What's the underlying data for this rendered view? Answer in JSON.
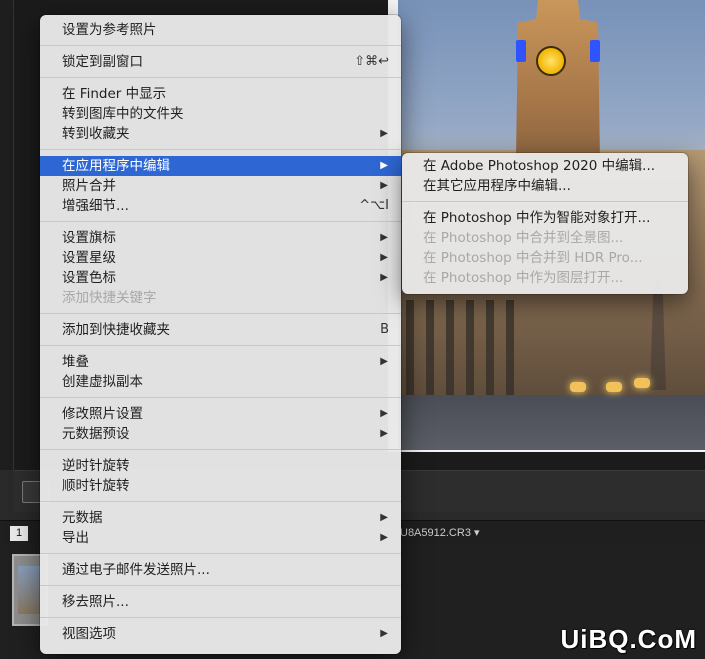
{
  "background": {
    "page_number": "1",
    "filename": "U8A5912.CR3 ▾"
  },
  "menu": {
    "items": [
      {
        "label": "设置为参考照片"
      },
      {
        "separator": true
      },
      {
        "label": "锁定到副窗口",
        "shortcut": "⇧⌘↩"
      },
      {
        "separator": true
      },
      {
        "label": "在 Finder 中显示"
      },
      {
        "label": "转到图库中的文件夹"
      },
      {
        "label": "转到收藏夹",
        "submenu": true
      },
      {
        "separator": true
      },
      {
        "label": "在应用程序中编辑",
        "submenu": true,
        "highlighted": true
      },
      {
        "label": "照片合并",
        "submenu": true
      },
      {
        "label": "增强细节...",
        "shortcut": "^⌥I"
      },
      {
        "separator": true
      },
      {
        "label": "设置旗标",
        "submenu": true
      },
      {
        "label": "设置星级",
        "submenu": true
      },
      {
        "label": "设置色标",
        "submenu": true
      },
      {
        "label": "添加快捷关键字",
        "disabled": true
      },
      {
        "separator": true
      },
      {
        "label": "添加到快捷收藏夹",
        "shortcut": "B"
      },
      {
        "separator": true
      },
      {
        "label": "堆叠",
        "submenu": true
      },
      {
        "label": "创建虚拟副本"
      },
      {
        "separator": true
      },
      {
        "label": "修改照片设置",
        "submenu": true
      },
      {
        "label": "元数据预设",
        "submenu": true
      },
      {
        "separator": true
      },
      {
        "label": "逆时针旋转"
      },
      {
        "label": "顺时针旋转"
      },
      {
        "separator": true
      },
      {
        "label": "元数据",
        "submenu": true
      },
      {
        "label": "导出",
        "submenu": true
      },
      {
        "separator": true
      },
      {
        "label": "通过电子邮件发送照片..."
      },
      {
        "separator": true
      },
      {
        "label": "移去照片..."
      },
      {
        "separator": true
      },
      {
        "label": "视图选项",
        "submenu": true
      }
    ]
  },
  "submenu": {
    "items": [
      {
        "label": "在 Adobe Photoshop 2020 中编辑..."
      },
      {
        "label": "在其它应用程序中编辑..."
      },
      {
        "separator": true
      },
      {
        "label": "在 Photoshop 中作为智能对象打开..."
      },
      {
        "label": "在 Photoshop 中合并到全景图...",
        "disabled": true
      },
      {
        "label": "在 Photoshop 中合并到 HDR Pro...",
        "disabled": true
      },
      {
        "label": "在 Photoshop 中作为图层打开...",
        "disabled": true
      }
    ]
  },
  "icons": {
    "submenu_arrow": "triangle-right-icon"
  },
  "colors": {
    "highlight": "#2e67d3",
    "menu_bg": "#e8e8e8",
    "disabled_text": "#a8a8a8"
  },
  "watermark": "UiBQ.CoM"
}
